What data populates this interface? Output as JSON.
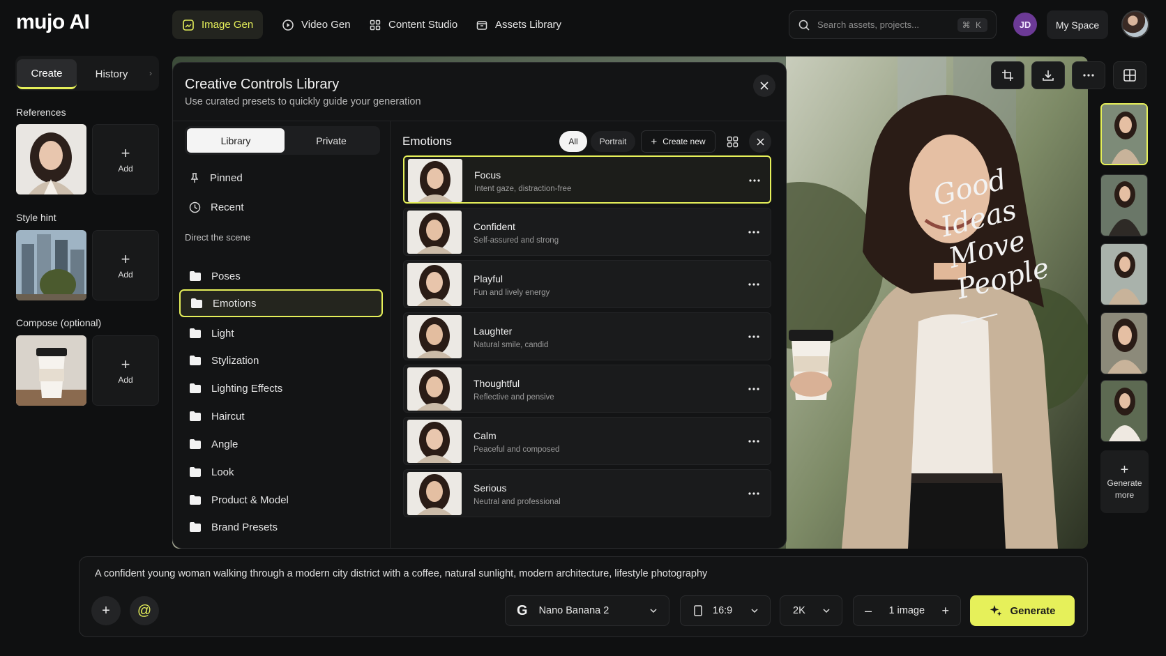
{
  "app": {
    "logo": "mujo AI"
  },
  "nav": {
    "tabs": [
      {
        "label": "Image Gen",
        "icon": "image-icon",
        "active": true
      },
      {
        "label": "Video Gen",
        "icon": "video-icon",
        "active": false
      },
      {
        "label": "Content Studio",
        "icon": "grid-icon",
        "active": false
      },
      {
        "label": "Assets Library",
        "icon": "folder-icon",
        "active": false
      }
    ]
  },
  "search": {
    "placeholder": "Search assets, projects...",
    "shortcut": "⌘ K"
  },
  "user": {
    "initials": "JD",
    "space_label": "My Space"
  },
  "left": {
    "tabs": {
      "create": "Create",
      "history": "History"
    },
    "references_label": "References",
    "style_hint_label": "Style hint",
    "compose_label": "Compose (optional)",
    "add_label": "Add"
  },
  "modal": {
    "title": "Creative Controls Library",
    "subtitle": "Use curated presets to quickly guide your generation",
    "tabs": {
      "library": "Library",
      "private": "Private"
    },
    "pinned": "Pinned",
    "recent": "Recent",
    "section_head": "Direct the scene",
    "categories": [
      {
        "label": "Poses",
        "active": false
      },
      {
        "label": "Emotions",
        "active": true
      },
      {
        "label": "Light",
        "active": false
      },
      {
        "label": "Stylization",
        "active": false
      },
      {
        "label": "Lighting Effects",
        "active": false
      },
      {
        "label": "Haircut",
        "active": false
      },
      {
        "label": "Angle",
        "active": false
      },
      {
        "label": "Look",
        "active": false
      },
      {
        "label": "Product & Model",
        "active": false
      },
      {
        "label": "Brand Presets",
        "active": false
      }
    ],
    "panel_title": "Emotions",
    "filters": {
      "all": "All",
      "portrait": "Portrait"
    },
    "create_new": "Create new",
    "presets": [
      {
        "name": "Focus",
        "desc": "Intent gaze, distraction-free",
        "active": true
      },
      {
        "name": "Confident",
        "desc": "Self-assured and strong",
        "active": false
      },
      {
        "name": "Playful",
        "desc": "Fun and lively energy",
        "active": false
      },
      {
        "name": "Laughter",
        "desc": "Natural smile, candid",
        "active": false
      },
      {
        "name": "Thoughtful",
        "desc": "Reflective and pensive",
        "active": false
      },
      {
        "name": "Calm",
        "desc": "Peaceful and composed",
        "active": false
      },
      {
        "name": "Serious",
        "desc": "Neutral and professional",
        "active": false
      }
    ]
  },
  "canvas": {
    "script_lines": [
      "Good",
      "Ideas",
      "Move",
      "People"
    ],
    "generate_more": "Generate more"
  },
  "prompt": {
    "text": "A confident young woman walking through a modern city district with a coffee, natural sunlight, modern architecture, lifestyle photography",
    "model": "Nano Banana 2",
    "ratio": "16:9",
    "resolution": "2K",
    "count": "1 image",
    "generate": "Generate"
  },
  "colors": {
    "accent": "#e6f05a",
    "bg": "#0f1011",
    "panel": "#131415",
    "avatar": "#6c3a96"
  }
}
